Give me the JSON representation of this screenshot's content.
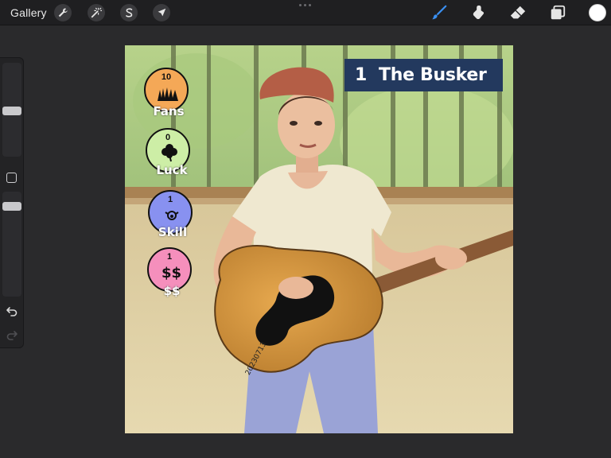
{
  "app": {
    "gallery_label": "Gallery",
    "accent_color": "#3a8ff0"
  },
  "toolbar": {
    "left_tools": [
      {
        "name": "actions",
        "icon": "wrench-icon"
      },
      {
        "name": "adjustments",
        "icon": "magic-wand-icon"
      },
      {
        "name": "selection",
        "icon": "selection-s-icon"
      },
      {
        "name": "transform",
        "icon": "arrow-cursor-icon"
      }
    ],
    "right_tools": [
      {
        "name": "brush",
        "icon": "brush-icon",
        "active": true
      },
      {
        "name": "smudge",
        "icon": "smudge-icon"
      },
      {
        "name": "eraser",
        "icon": "eraser-icon"
      },
      {
        "name": "layers",
        "icon": "layers-icon"
      }
    ],
    "current_color": "#ffffff"
  },
  "sidebar": {
    "brush_size_label": "",
    "opacity_label": ""
  },
  "artwork": {
    "card_number": "1",
    "card_title": "The Busker",
    "stats": [
      {
        "value": "10",
        "label": "Fans",
        "color": "#f4a857",
        "icon": "crowd-hands-icon"
      },
      {
        "value": "0",
        "label": "Luck",
        "color": "#cdeea6",
        "icon": "clover-icon"
      },
      {
        "value": "1",
        "label": "Skill",
        "color": "#8891f0",
        "icon": "clown-icon"
      },
      {
        "value": "1",
        "label": "$$",
        "color": "#f58fbc",
        "icon": "dollar-icon"
      }
    ],
    "signature_date": "20230713"
  }
}
